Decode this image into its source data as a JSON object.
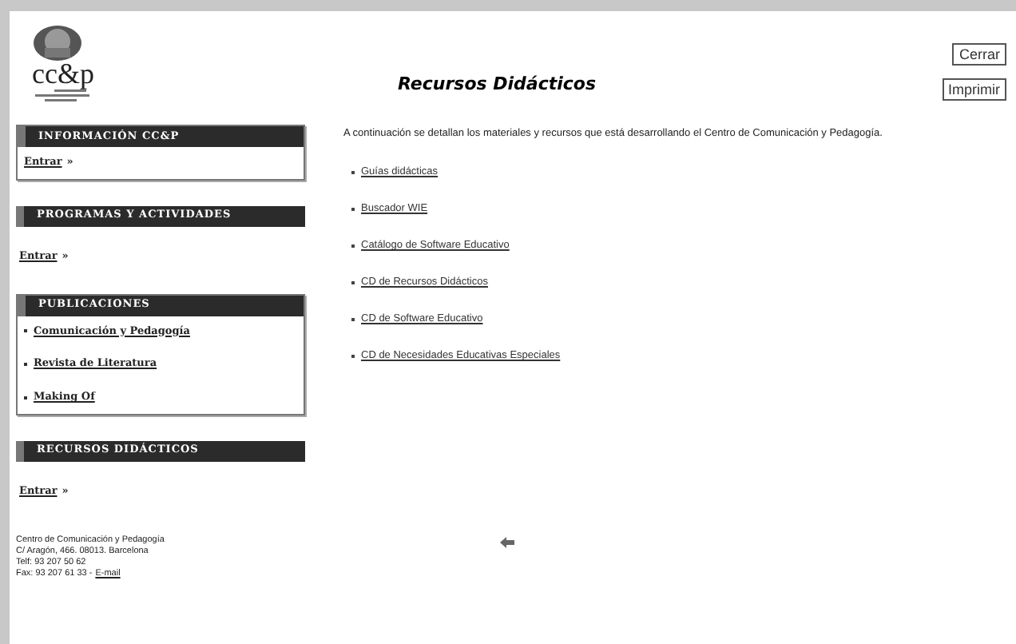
{
  "logo": {
    "text": "cc&p"
  },
  "sidebar": {
    "sections": [
      {
        "title": "INFORMACIÓN CC&P",
        "kind": "boxed",
        "entries": [
          {
            "kind": "enter",
            "link": "Entrar",
            "suffix": "»"
          }
        ]
      },
      {
        "title": "PROGRAMAS Y ACTIVIDADES",
        "kind": "plain",
        "entries": [
          {
            "kind": "enter",
            "link": "Entrar",
            "suffix": "»"
          }
        ]
      },
      {
        "title": "PUBLICACIONES",
        "kind": "boxed",
        "entries": [
          {
            "kind": "bullet",
            "link": "Comunicación y Pedagogía"
          },
          {
            "kind": "bullet",
            "link": "Revista de Literatura"
          },
          {
            "kind": "bullet",
            "link": "Making Of"
          }
        ]
      },
      {
        "title": "RECURSOS DIDÁCTICOS",
        "kind": "plain",
        "entries": [
          {
            "kind": "enter",
            "link": "Entrar",
            "suffix": "»"
          }
        ]
      }
    ],
    "address": {
      "lines": [
        "Centro de Comunicación y Pedagogía",
        "C/ Aragón, 466. 08013. Barcelona",
        "Telf: 93 207 50 62"
      ],
      "fax": "Fax: 93 207 61 33 -",
      "email_link": "E-mail"
    }
  },
  "main": {
    "title": "Recursos Didácticos",
    "buttons": [
      "Cerrar",
      "Imprimir"
    ],
    "intro": "A continuación se detallan los materiales y recursos que está desarrollando el Centro de Comunicación y Pedagogía.",
    "links": [
      "Guías didácticas",
      "Buscador WIE",
      "Catálogo de Software Educativo",
      "CD de Recursos Didácticos",
      "CD de Software Educativo",
      "CD de Necesidades Educativas Especiales"
    ]
  }
}
